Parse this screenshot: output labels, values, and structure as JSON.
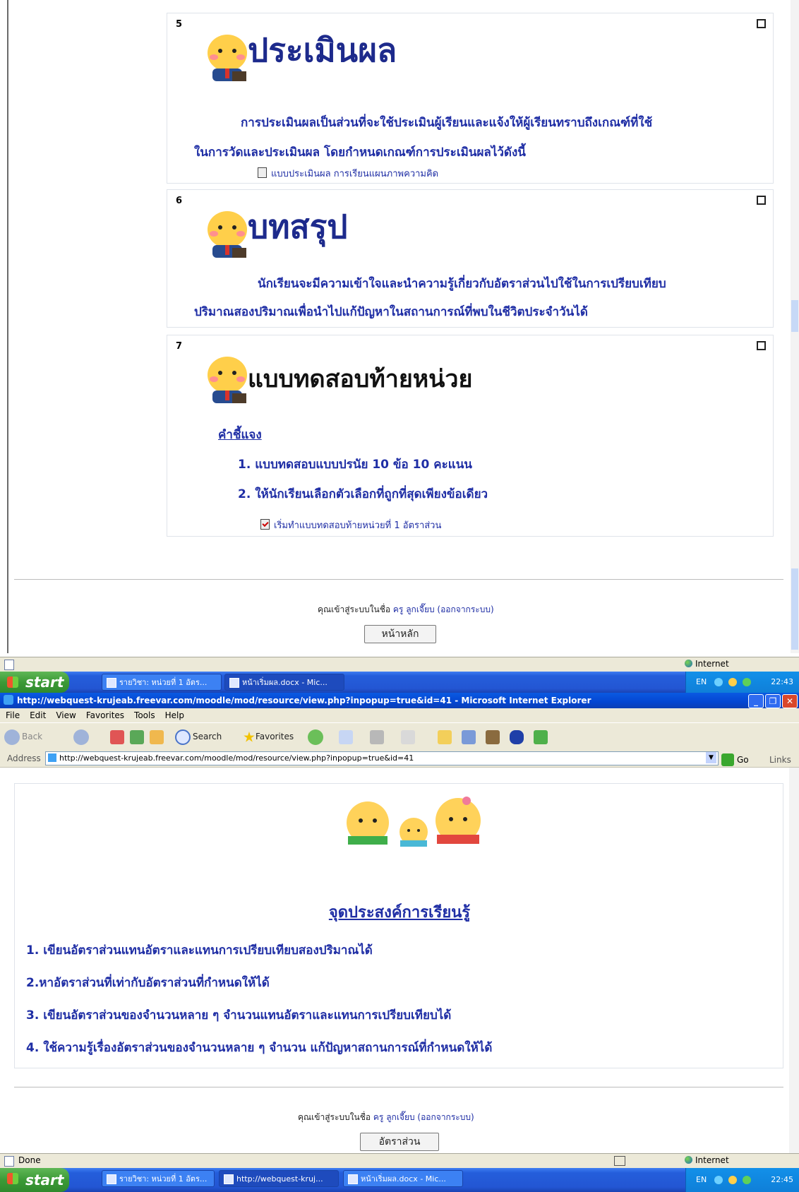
{
  "top_window": {
    "sections": [
      {
        "number": "5",
        "banner_title": "ประเมินผล",
        "paragraph_line1": "การประเมินผลเป็นส่วนที่จะใช้ประเมินผู้เรียนและแจ้งให้ผู้เรียนทราบถึงเกณฑ์ที่ใช้",
        "paragraph_line2": "ในการวัดและประเมินผล โดยกำหนดเกณฑ์การประเมินผลไว้ดังนี้",
        "resource_link": "แบบประเมินผล การเรียนแผนภาพความคิด"
      },
      {
        "number": "6",
        "banner_title": "บทสรุป",
        "paragraph_line1": "นักเรียนจะมีความเข้าใจและนำความรู้เกี่ยวกับอัตราส่วนไปใช้ในการเปรียบเทียบ",
        "paragraph_line2": "ปริมาณสองปริมาณเพื่อนำไปแก้ปัญหาในสถานการณ์ที่พบในชีวิตประจำวันได้"
      },
      {
        "number": "7",
        "banner_title": "แบบทดสอบท้ายหน่วย",
        "instructions_heading": "คำชี้แจง",
        "instruction_1": "1. แบบทดสอบแบบปรนัย 10 ข้อ 10 คะแนน",
        "instruction_2": "2. ให้นักเรียนเลือกตัวเลือกที่ถูกที่สุดเพียงข้อเดียว",
        "quiz_link": "เริ่มทำแบบทดสอบท้ายหน่วยที่ 1 อัตราส่วน"
      }
    ],
    "footer": {
      "login_prefix": "คุณเข้าสู่ระบบในชื่อ",
      "user_name": "ครู ลูกเจี๊ยบ",
      "logout_text": "(ออกจากระบบ)",
      "home_button": "หน้าหลัก"
    },
    "status_zone": "Internet"
  },
  "taskbar_top": {
    "start_label": "start",
    "items": [
      "รายวิชา: หน่วยที่ 1 อัตร...",
      "หน้าเริ่มผล.docx - Mic..."
    ],
    "lang": "EN",
    "clock": "22:43"
  },
  "browser": {
    "title": "http://webquest-krujeab.freevar.com/moodle/mod/resource/view.php?inpopup=true&id=41 - Microsoft Internet Explorer",
    "menu": [
      "File",
      "Edit",
      "View",
      "Favorites",
      "Tools",
      "Help"
    ],
    "toolbar": {
      "back": "Back",
      "search": "Search",
      "favorites": "Favorites"
    },
    "address_label": "Address",
    "address_value": "http://webquest-krujeab.freevar.com/moodle/mod/resource/view.php?inpopup=true&id=41",
    "go_label": "Go",
    "links_label": "Links"
  },
  "objectives": {
    "heading": "จุดประสงค์การเรียนรู้",
    "items": [
      "1. เขียนอัตราส่วนแทนอัตราและแทนการเปรียบเทียบสองปริมาณได้",
      "2.หาอัตราส่วนที่เท่ากับอัตราส่วนที่กำหนดให้ได้",
      "3. เขียนอัตราส่วนของจำนวนหลาย ๆ จำนวนแทนอัตราและแทนการเปรียบเทียบได้",
      "4. ใช้ความรู้เรื่องอัตราส่วนของจำนวนหลาย ๆ จำนวน แก้ปัญหาสถานการณ์ที่กำหนดให้ได้"
    ],
    "footer": {
      "login_prefix": "คุณเข้าสู่ระบบในชื่อ",
      "user_name": "ครู ลูกเจี๊ยบ",
      "logout_text": "(ออกจากระบบ)",
      "course_button": "อัตราส่วน"
    },
    "status_left": "Done",
    "status_zone": "Internet"
  },
  "taskbar_bottom": {
    "start_label": "start",
    "items": [
      "รายวิชา: หน่วยที่ 1 อัตร...",
      "http://webquest-kruj...",
      "หน้าเริ่มผล.docx - Mic..."
    ],
    "lang": "EN",
    "clock": "22:45"
  }
}
